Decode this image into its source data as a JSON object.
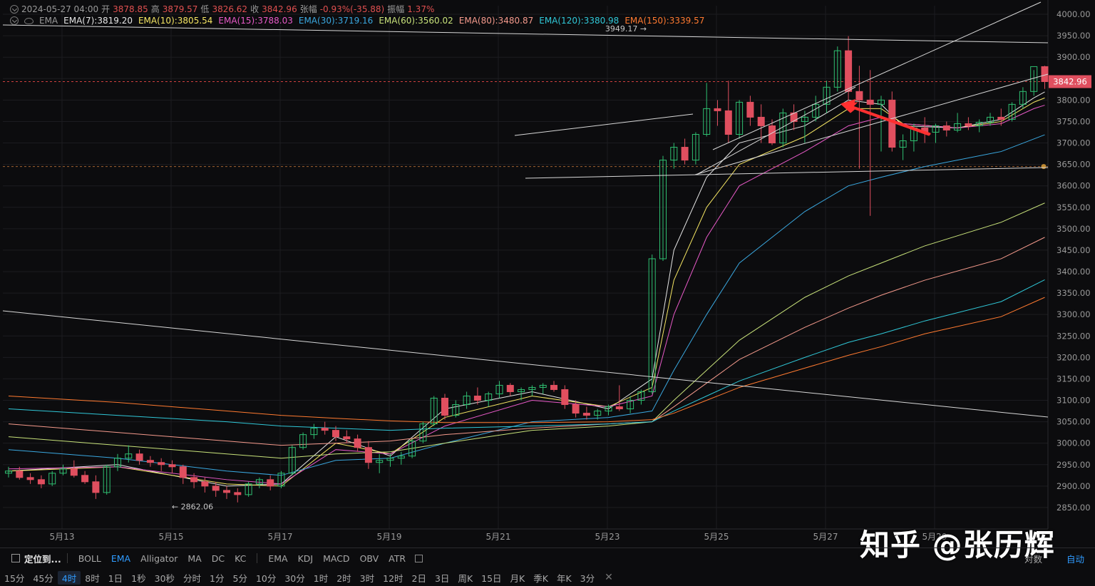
{
  "header": {
    "datetime": "2024-05-27 04:00",
    "open_label": "开",
    "open": "3878.85",
    "high_label": "高",
    "high": "3879.57",
    "low_label": "低",
    "low": "3826.62",
    "close_label": "收",
    "close": "3842.96",
    "change_label": "张幅",
    "change": "-0.93%(-35.88)",
    "amplitude_label": "振幅",
    "amplitude": "1.37%",
    "indicator": "EMA"
  },
  "ema_legend": [
    {
      "label": "EMA(7):3819.20",
      "color": "#e6e6e6"
    },
    {
      "label": "EMA(10):3805.54",
      "color": "#f5e663"
    },
    {
      "label": "EMA(15):3788.03",
      "color": "#e85ac8"
    },
    {
      "label": "EMA(30):3719.16",
      "color": "#3aa8e0"
    },
    {
      "label": "EMA(60):3560.02",
      "color": "#c8e27a"
    },
    {
      "label": "EMA(80):3480.87",
      "color": "#f59a8c"
    },
    {
      "label": "EMA(120):3380.98",
      "color": "#30c8d8"
    },
    {
      "label": "EMA(150):3339.57",
      "color": "#ff7a30"
    }
  ],
  "chart_data": {
    "type": "candlestick",
    "ylim": [
      2800,
      4020
    ],
    "y_ticks": [
      "4000.00",
      "3950.00",
      "3900.00",
      "3850.00",
      "3800.00",
      "3750.00",
      "3700.00",
      "3650.00",
      "3600.00",
      "3550.00",
      "3500.00",
      "3450.00",
      "3400.00",
      "3350.00",
      "3300.00",
      "3250.00",
      "3200.00",
      "3150.00",
      "3100.00",
      "3050.00",
      "3000.00",
      "2950.00",
      "2900.00",
      "2850.00"
    ],
    "x_ticks": [
      "5月13",
      "5月15",
      "5月17",
      "5月19",
      "5月21",
      "5月23",
      "5月25",
      "5月27",
      "5月29"
    ],
    "current_price": "3842.96",
    "high_marker": "3949.17",
    "low_marker": "2862.06",
    "candles": [
      [
        2930,
        2945,
        2920,
        2935
      ],
      [
        2935,
        2945,
        2915,
        2920
      ],
      [
        2920,
        2930,
        2905,
        2915
      ],
      [
        2915,
        2925,
        2895,
        2905
      ],
      [
        2905,
        2935,
        2900,
        2930
      ],
      [
        2930,
        2950,
        2925,
        2940
      ],
      [
        2940,
        2960,
        2920,
        2925
      ],
      [
        2925,
        2935,
        2905,
        2910
      ],
      [
        2910,
        2925,
        2870,
        2885
      ],
      [
        2885,
        2950,
        2880,
        2945
      ],
      [
        2945,
        2975,
        2935,
        2965
      ],
      [
        2965,
        2995,
        2955,
        2975
      ],
      [
        2975,
        2985,
        2950,
        2960
      ],
      [
        2960,
        2970,
        2945,
        2955
      ],
      [
        2955,
        2965,
        2935,
        2950
      ],
      [
        2950,
        2960,
        2930,
        2945
      ],
      [
        2945,
        2950,
        2905,
        2920
      ],
      [
        2920,
        2930,
        2895,
        2910
      ],
      [
        2910,
        2920,
        2885,
        2900
      ],
      [
        2900,
        2910,
        2875,
        2890
      ],
      [
        2890,
        2900,
        2870,
        2885
      ],
      [
        2885,
        2895,
        2862,
        2880
      ],
      [
        2880,
        2910,
        2875,
        2905
      ],
      [
        2905,
        2920,
        2895,
        2915
      ],
      [
        2915,
        2925,
        2890,
        2900
      ],
      [
        2900,
        2935,
        2895,
        2930
      ],
      [
        2930,
        2995,
        2925,
        2990
      ],
      [
        2990,
        3025,
        2985,
        3020
      ],
      [
        3020,
        3045,
        3010,
        3035
      ],
      [
        3035,
        3050,
        3020,
        3030
      ],
      [
        3030,
        3040,
        3005,
        3015
      ],
      [
        3015,
        3030,
        3000,
        3010
      ],
      [
        3010,
        3020,
        2980,
        2990
      ],
      [
        2990,
        3005,
        2940,
        2955
      ],
      [
        2955,
        2975,
        2930,
        2960
      ],
      [
        2960,
        2975,
        2945,
        2965
      ],
      [
        2965,
        2980,
        2950,
        2970
      ],
      [
        2970,
        3010,
        2965,
        3005
      ],
      [
        3005,
        3050,
        3000,
        3045
      ],
      [
        3045,
        3110,
        3040,
        3105
      ],
      [
        3105,
        3115,
        3055,
        3065
      ],
      [
        3065,
        3100,
        3060,
        3090
      ],
      [
        3090,
        3120,
        3080,
        3110
      ],
      [
        3110,
        3130,
        3090,
        3100
      ],
      [
        3100,
        3120,
        3085,
        3115
      ],
      [
        3115,
        3145,
        3105,
        3135
      ],
      [
        3135,
        3140,
        3110,
        3120
      ],
      [
        3120,
        3130,
        3100,
        3125
      ],
      [
        3125,
        3135,
        3110,
        3130
      ],
      [
        3130,
        3140,
        3115,
        3135
      ],
      [
        3135,
        3145,
        3120,
        3125
      ],
      [
        3125,
        3135,
        3080,
        3090
      ],
      [
        3090,
        3100,
        3060,
        3070
      ],
      [
        3070,
        3085,
        3055,
        3065
      ],
      [
        3065,
        3080,
        3055,
        3075
      ],
      [
        3075,
        3090,
        3065,
        3085
      ],
      [
        3085,
        3135,
        3075,
        3080
      ],
      [
        3080,
        3110,
        3070,
        3100
      ],
      [
        3100,
        3125,
        3090,
        3120
      ],
      [
        3120,
        3440,
        3115,
        3430
      ],
      [
        3430,
        3670,
        3425,
        3660
      ],
      [
        3660,
        3700,
        3640,
        3690
      ],
      [
        3690,
        3710,
        3650,
        3660
      ],
      [
        3660,
        3725,
        3650,
        3720
      ],
      [
        3720,
        3840,
        3715,
        3780
      ],
      [
        3780,
        3800,
        3740,
        3775
      ],
      [
        3775,
        3845,
        3700,
        3720
      ],
      [
        3720,
        3800,
        3710,
        3795
      ],
      [
        3795,
        3810,
        3740,
        3760
      ],
      [
        3760,
        3790,
        3700,
        3740
      ],
      [
        3740,
        3755,
        3695,
        3700
      ],
      [
        3700,
        3780,
        3690,
        3770
      ],
      [
        3770,
        3790,
        3730,
        3750
      ],
      [
        3750,
        3775,
        3700,
        3760
      ],
      [
        3760,
        3810,
        3750,
        3790
      ],
      [
        3790,
        3845,
        3770,
        3830
      ],
      [
        3830,
        3925,
        3820,
        3915
      ],
      [
        3915,
        3949,
        3800,
        3820
      ],
      [
        3820,
        3880,
        3640,
        3800
      ],
      [
        3800,
        3870,
        3530,
        3790
      ],
      [
        3790,
        3810,
        3680,
        3800
      ],
      [
        3800,
        3820,
        3680,
        3690
      ],
      [
        3690,
        3720,
        3660,
        3705
      ],
      [
        3705,
        3745,
        3680,
        3735
      ],
      [
        3735,
        3760,
        3700,
        3725
      ],
      [
        3725,
        3745,
        3700,
        3740
      ],
      [
        3740,
        3750,
        3715,
        3730
      ],
      [
        3730,
        3770,
        3725,
        3745
      ],
      [
        3745,
        3760,
        3730,
        3740
      ],
      [
        3740,
        3755,
        3725,
        3748
      ],
      [
        3748,
        3770,
        3740,
        3760
      ],
      [
        3760,
        3780,
        3740,
        3755
      ],
      [
        3755,
        3795,
        3750,
        3790
      ],
      [
        3790,
        3830,
        3780,
        3820
      ],
      [
        3820,
        3870,
        3810,
        3878
      ],
      [
        3878,
        3880,
        3826,
        3843
      ]
    ],
    "ema_series": [
      {
        "period": 7,
        "color": "#e6e6e6",
        "values": [
          [
            0,
            2935
          ],
          [
            10,
            2950
          ],
          [
            20,
            2900
          ],
          [
            25,
            2905
          ],
          [
            30,
            3015
          ],
          [
            35,
            2970
          ],
          [
            40,
            3080
          ],
          [
            48,
            3120
          ],
          [
            55,
            3080
          ],
          [
            59,
            3150
          ],
          [
            61,
            3450
          ],
          [
            64,
            3620
          ],
          [
            67,
            3700
          ],
          [
            73,
            3740
          ],
          [
            77,
            3800
          ],
          [
            80,
            3790
          ],
          [
            82,
            3740
          ],
          [
            87,
            3735
          ],
          [
            91,
            3755
          ],
          [
            94,
            3805
          ],
          [
            95,
            3819
          ]
        ]
      },
      {
        "period": 10,
        "color": "#f5e663",
        "values": [
          [
            0,
            2935
          ],
          [
            10,
            2945
          ],
          [
            20,
            2905
          ],
          [
            25,
            2900
          ],
          [
            30,
            3000
          ],
          [
            35,
            2975
          ],
          [
            40,
            3060
          ],
          [
            48,
            3110
          ],
          [
            55,
            3085
          ],
          [
            59,
            3130
          ],
          [
            61,
            3380
          ],
          [
            64,
            3550
          ],
          [
            67,
            3650
          ],
          [
            73,
            3715
          ],
          [
            77,
            3780
          ],
          [
            80,
            3780
          ],
          [
            82,
            3745
          ],
          [
            87,
            3735
          ],
          [
            91,
            3750
          ],
          [
            94,
            3795
          ],
          [
            95,
            3805
          ]
        ]
      },
      {
        "period": 15,
        "color": "#e85ac8",
        "values": [
          [
            0,
            2940
          ],
          [
            10,
            2945
          ],
          [
            20,
            2915
          ],
          [
            25,
            2905
          ],
          [
            30,
            2985
          ],
          [
            35,
            2975
          ],
          [
            40,
            3040
          ],
          [
            48,
            3100
          ],
          [
            55,
            3085
          ],
          [
            59,
            3110
          ],
          [
            61,
            3300
          ],
          [
            64,
            3480
          ],
          [
            67,
            3600
          ],
          [
            73,
            3680
          ],
          [
            77,
            3740
          ],
          [
            80,
            3760
          ],
          [
            82,
            3745
          ],
          [
            87,
            3735
          ],
          [
            91,
            3745
          ],
          [
            94,
            3780
          ],
          [
            95,
            3788
          ]
        ]
      },
      {
        "period": 30,
        "color": "#3aa8e0",
        "values": [
          [
            0,
            2985
          ],
          [
            10,
            2965
          ],
          [
            20,
            2935
          ],
          [
            25,
            2925
          ],
          [
            30,
            2960
          ],
          [
            35,
            2965
          ],
          [
            40,
            3000
          ],
          [
            48,
            3050
          ],
          [
            55,
            3060
          ],
          [
            59,
            3075
          ],
          [
            61,
            3170
          ],
          [
            64,
            3300
          ],
          [
            67,
            3420
          ],
          [
            73,
            3540
          ],
          [
            77,
            3600
          ],
          [
            80,
            3620
          ],
          [
            84,
            3645
          ],
          [
            91,
            3680
          ],
          [
            95,
            3719
          ]
        ]
      },
      {
        "period": 60,
        "color": "#c8e27a",
        "values": [
          [
            0,
            3015
          ],
          [
            10,
            2995
          ],
          [
            20,
            2975
          ],
          [
            25,
            2965
          ],
          [
            30,
            2975
          ],
          [
            35,
            2980
          ],
          [
            40,
            3000
          ],
          [
            48,
            3030
          ],
          [
            55,
            3040
          ],
          [
            59,
            3050
          ],
          [
            61,
            3100
          ],
          [
            64,
            3170
          ],
          [
            67,
            3240
          ],
          [
            73,
            3340
          ],
          [
            77,
            3390
          ],
          [
            80,
            3420
          ],
          [
            84,
            3460
          ],
          [
            91,
            3515
          ],
          [
            95,
            3560
          ]
        ]
      },
      {
        "period": 80,
        "color": "#f59a8c",
        "values": [
          [
            0,
            3045
          ],
          [
            10,
            3025
          ],
          [
            20,
            3005
          ],
          [
            25,
            2995
          ],
          [
            30,
            3000
          ],
          [
            35,
            3005
          ],
          [
            40,
            3020
          ],
          [
            48,
            3035
          ],
          [
            55,
            3045
          ],
          [
            59,
            3050
          ],
          [
            61,
            3085
          ],
          [
            64,
            3140
          ],
          [
            67,
            3195
          ],
          [
            73,
            3270
          ],
          [
            77,
            3315
          ],
          [
            80,
            3345
          ],
          [
            84,
            3380
          ],
          [
            91,
            3430
          ],
          [
            95,
            3480
          ]
        ]
      },
      {
        "period": 120,
        "color": "#30c8d8",
        "values": [
          [
            0,
            3080
          ],
          [
            10,
            3065
          ],
          [
            20,
            3050
          ],
          [
            25,
            3040
          ],
          [
            30,
            3035
          ],
          [
            35,
            3030
          ],
          [
            40,
            3035
          ],
          [
            48,
            3040
          ],
          [
            55,
            3045
          ],
          [
            59,
            3050
          ],
          [
            61,
            3075
          ],
          [
            64,
            3110
          ],
          [
            67,
            3145
          ],
          [
            73,
            3200
          ],
          [
            77,
            3235
          ],
          [
            80,
            3255
          ],
          [
            84,
            3285
          ],
          [
            91,
            3330
          ],
          [
            95,
            3381
          ]
        ]
      },
      {
        "period": 150,
        "color": "#ff7a30",
        "values": [
          [
            0,
            3110
          ],
          [
            10,
            3095
          ],
          [
            20,
            3075
          ],
          [
            25,
            3065
          ],
          [
            30,
            3058
          ],
          [
            35,
            3052
          ],
          [
            40,
            3048
          ],
          [
            48,
            3048
          ],
          [
            55,
            3050
          ],
          [
            59,
            3055
          ],
          [
            61,
            3070
          ],
          [
            64,
            3100
          ],
          [
            67,
            3130
          ],
          [
            73,
            3175
          ],
          [
            77,
            3205
          ],
          [
            80,
            3225
          ],
          [
            84,
            3255
          ],
          [
            91,
            3295
          ],
          [
            95,
            3340
          ]
        ]
      }
    ],
    "trend_lines_color": "#d8d8d8",
    "arrow_color": "#ff3030"
  },
  "toolbar": {
    "locate_label": "定位到...",
    "indicators": [
      "BOLL",
      "EMA",
      "Alligator",
      "MA",
      "DC",
      "KC"
    ],
    "active_indicator": "EMA",
    "sub_indicators": [
      "EMA",
      "KDJ",
      "MACD",
      "OBV",
      "ATR"
    ],
    "right_labels": [
      "对数",
      "自动"
    ]
  },
  "periods": {
    "items": [
      "15分",
      "45分",
      "4时",
      "8时",
      "1日",
      "1秒",
      "30秒",
      "分时",
      "1分",
      "5分",
      "10分",
      "30分",
      "1时",
      "2时",
      "3时",
      "12时",
      "2日",
      "3日",
      "周K",
      "15日",
      "月K",
      "季K",
      "年K",
      "3分"
    ],
    "active": "4时"
  },
  "watermark": "知乎 @张历辉"
}
